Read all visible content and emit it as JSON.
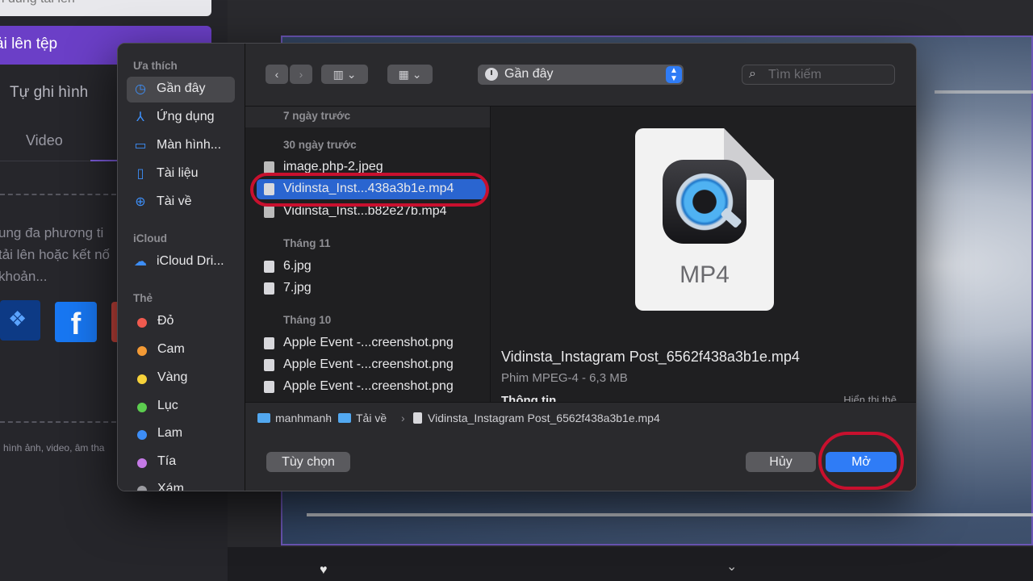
{
  "background": {
    "search_text": "i dung tải lên",
    "upload_button": "ải lên tệp",
    "record_tab": "Tự ghi hình",
    "video_tab": "Video",
    "drop_text": [
      "ung đa phương ti",
      "tải lên hoặc kết nố",
      "khoản..."
    ],
    "footer_text": "hình ảnh, video, âm tha"
  },
  "dialog": {
    "sidebar": {
      "favorites_header": "Ưa thích",
      "favorites": [
        {
          "label": "Gần đây",
          "icon": "clock-icon"
        },
        {
          "label": "Ứng dụng",
          "icon": "applications-icon"
        },
        {
          "label": "Màn hình...",
          "icon": "desktop-icon"
        },
        {
          "label": "Tài liệu",
          "icon": "document-icon"
        },
        {
          "label": "Tài về",
          "icon": "download-icon"
        }
      ],
      "icloud_header": "iCloud",
      "icloud": [
        {
          "label": "iCloud Dri...",
          "icon": "cloud-icon"
        }
      ],
      "tags_header": "Thẻ",
      "tags": [
        {
          "label": "Đỏ",
          "color": "#f05a4f"
        },
        {
          "label": "Cam",
          "color": "#f39a35"
        },
        {
          "label": "Vàng",
          "color": "#f7d23a"
        },
        {
          "label": "Lục",
          "color": "#5ccd4f"
        },
        {
          "label": "Lam",
          "color": "#3d8ef7"
        },
        {
          "label": "Tía",
          "color": "#c57ae6"
        },
        {
          "label": "Xám",
          "color": "#9a9a9f"
        }
      ]
    },
    "toolbar": {
      "back": "‹",
      "forward": "›",
      "location": "Gần đây",
      "search_placeholder": "Tìm kiếm"
    },
    "file_groups": [
      {
        "header": "7 ngày trước",
        "files": []
      },
      {
        "header": "30 ngày trước",
        "files": [
          "image.php-2.jpeg",
          "Vidinsta_Inst...438a3b1e.mp4",
          "Vidinsta_Inst...b82e27b.mp4"
        ]
      },
      {
        "header": "Tháng 11",
        "files": [
          "6.jpg",
          "7.jpg"
        ]
      },
      {
        "header": "Tháng 10",
        "files": [
          "Apple Event -...creenshot.png",
          "Apple Event -...creenshot.png",
          "Apple Event -...creenshot.png"
        ]
      }
    ],
    "selected_file": "Vidinsta_Inst...438a3b1e.mp4",
    "preview": {
      "extension": "MP4",
      "file_name": "Vidinsta_Instagram Post_6562f438a3b1e.mp4",
      "kind": "Phim MPEG-4 - 6,3 MB",
      "info_header": "Thông tin",
      "show_more": "Hiển thị thê"
    },
    "path": {
      "user": "manhmanh",
      "folder": "Tải về",
      "file": "Vidinsta_Instagram Post_6562f438a3b1e.mp4",
      "separator": "›"
    },
    "buttons": {
      "options": "Tùy chọn",
      "cancel": "Hủy",
      "open": "Mở"
    },
    "accent_color": "#2f7cf6"
  }
}
